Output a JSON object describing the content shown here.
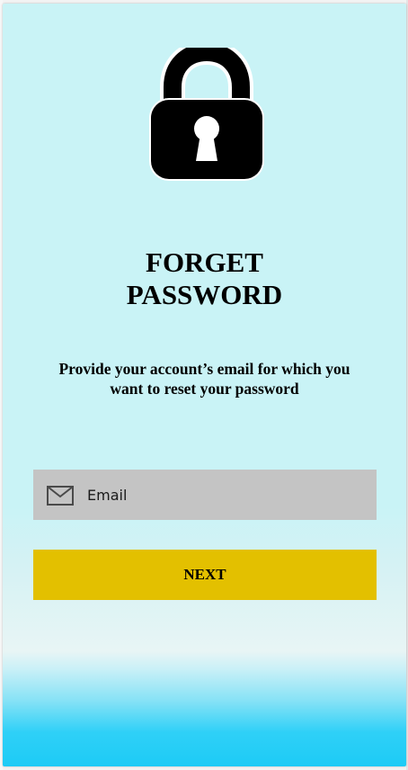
{
  "page": {
    "title_line1": "FORGET",
    "title_line2": "PASSWORD",
    "subtitle": "Provide your account’s email for which you want to reset your password"
  },
  "form": {
    "email_placeholder": "Email",
    "email_value": "",
    "next_label": "NEXT"
  },
  "icons": {
    "lock": "lock-icon",
    "email": "mail-icon"
  },
  "colors": {
    "background": "#c9f3f6",
    "field": "#c4c4c4",
    "button": "#e3c000",
    "bottom_gradient": "#1dcbf6"
  }
}
